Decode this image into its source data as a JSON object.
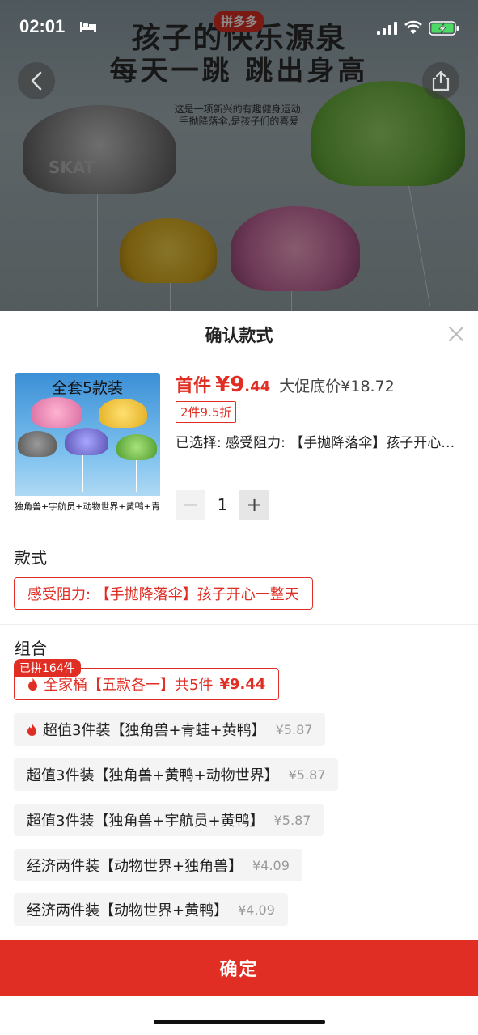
{
  "status_bar": {
    "time": "02:01"
  },
  "banner": {
    "brand": "拼多多",
    "line1": "孩子的快乐源泉",
    "line2": "每天一跳  跳出身高",
    "sub1": "这是一项新兴的有趣健身运动,",
    "sub2": "手抛降落伞,是孩子们的喜爱",
    "chute_label": "SKAT"
  },
  "sheet": {
    "title": "确认款式",
    "product_image": {
      "top_text": "全套5款装",
      "bottom_text": "独角兽+宇航员+动物世界+黄鸭+青蛙"
    },
    "price": {
      "first_label": "首件",
      "currency": "¥",
      "int": "9",
      "dec": ".44",
      "promo": "大促底价¥18.72"
    },
    "discount_tag": "2件9.5折",
    "selected": "已选择: 感受阻力: 【手抛降落伞】孩子开心一整天",
    "quantity": {
      "value": "1",
      "minus": "−",
      "plus": "+"
    },
    "style_section": {
      "label": "款式",
      "options": [
        {
          "label": "感受阻力: 【手抛降落伞】孩子开心一整天",
          "selected": true
        }
      ]
    },
    "combo_section": {
      "label": "组合",
      "badge": "已拼164件",
      "options": [
        {
          "label": "全家桶【五款各一】共5件",
          "price": "¥9.44",
          "hot": true,
          "selected": true
        },
        {
          "label": "超值3件装【独角兽+青蛙+黄鸭】",
          "price": "¥5.87",
          "hot": true,
          "selected": false
        },
        {
          "label": "超值3件装【独角兽+黄鸭+动物世界】",
          "price": "¥5.87",
          "hot": false,
          "selected": false
        },
        {
          "label": "超值3件装【独角兽+宇航员+黄鸭】",
          "price": "¥5.87",
          "hot": false,
          "selected": false
        },
        {
          "label": "经济两件装【动物世界+独角兽】",
          "price": "¥4.09",
          "hot": false,
          "selected": false
        },
        {
          "label": "经济两件装【动物世界+黄鸭】",
          "price": "¥4.09",
          "hot": false,
          "selected": false
        }
      ]
    },
    "confirm_label": "确定"
  },
  "colors": {
    "accent": "#e02e24",
    "chip_bg": "#f4f4f4"
  },
  "icons": [
    "bed-icon",
    "signal-icon",
    "wifi-icon",
    "battery-icon",
    "back-icon",
    "share-icon",
    "close-icon",
    "fire-icon"
  ]
}
